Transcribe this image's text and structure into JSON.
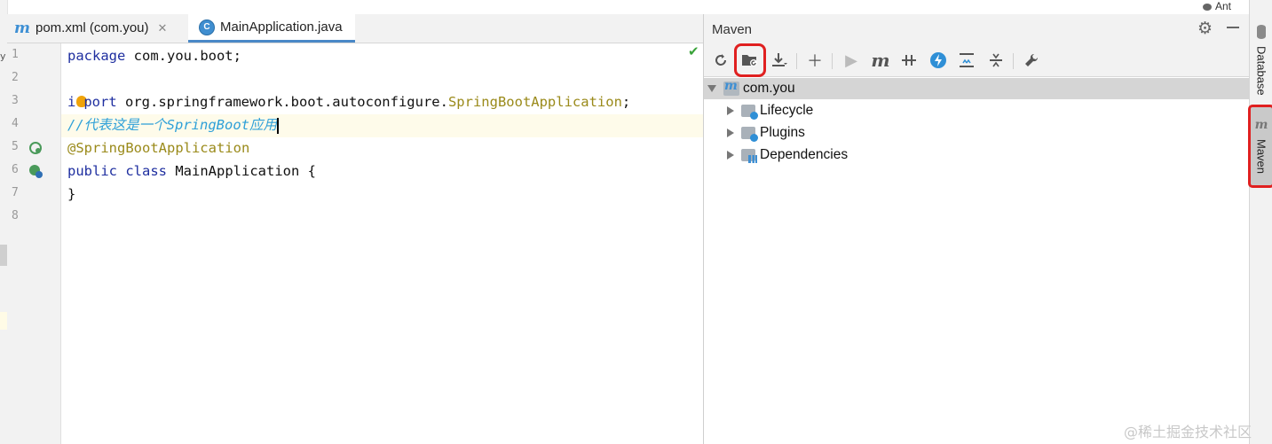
{
  "tabs": [
    {
      "label": "pom.xml (com.you)",
      "icon": "maven-m-icon"
    },
    {
      "label": "MainApplication.java",
      "icon": "java-class-icon",
      "active": true
    }
  ],
  "editor": {
    "line_numbers": [
      "1",
      "2",
      "3",
      "4",
      "5",
      "6",
      "7",
      "8"
    ],
    "lines": {
      "l1_kw": "package",
      "l1_rest": " com.you.boot;",
      "l3_kw_a": "i",
      "l3_kw_b": "port",
      "l3_rest": " org.springframework.boot.autoconfigure.",
      "l3_ann": "SpringBootApplication",
      "l3_end": ";",
      "l4_comment": "//代表这是一个SpringBoot应用",
      "l5_ann": "@SpringBootApplication",
      "l6_kw1": "public",
      "l6_kw2": "class",
      "l6_rest": " MainApplication {",
      "l7": "}"
    }
  },
  "left_strip_glyph": "y",
  "maven": {
    "title": "Maven",
    "root": "com.you",
    "children": [
      "Lifecycle",
      "Plugins",
      "Dependencies"
    ]
  },
  "right_strip": {
    "ant_label": "Ant",
    "database_label": "Database",
    "maven_label": "Maven"
  },
  "watermark": "@稀土掘金技术社区",
  "colors": {
    "highlight_box": "#e02020",
    "active_tab_underline": "#4a88c7",
    "keyword": "#1f2fa0",
    "annotation": "#9a8a1a",
    "comment": "#2ea0d8"
  }
}
